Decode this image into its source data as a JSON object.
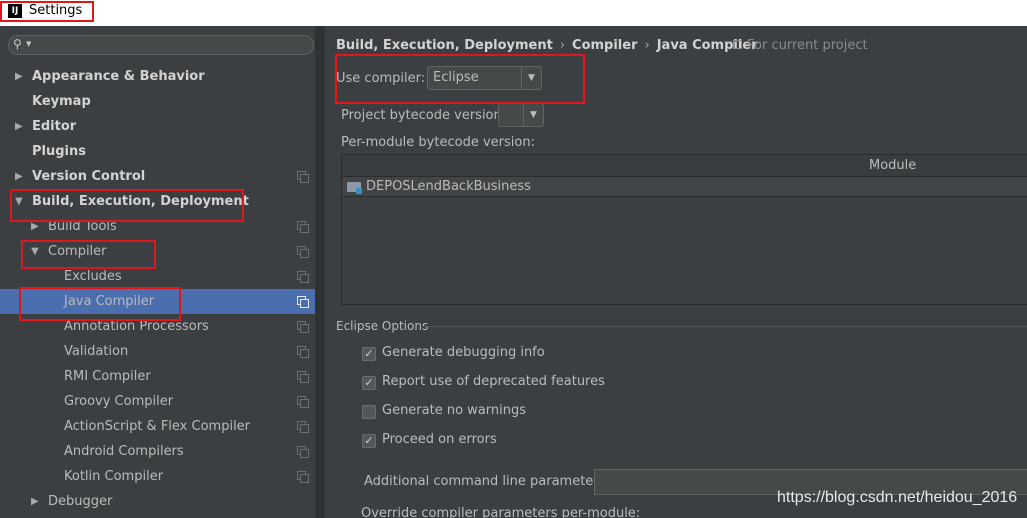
{
  "window": {
    "title": "Settings",
    "logo_text": "IJ"
  },
  "sidebar": {
    "search_placeholder": "",
    "items": [
      {
        "label": "Appearance & Behavior",
        "bold": true,
        "level": 0,
        "arrow": "▶",
        "project_icon": false
      },
      {
        "label": "Keymap",
        "bold": true,
        "level": 0,
        "arrow": "",
        "project_icon": false
      },
      {
        "label": "Editor",
        "bold": true,
        "level": 0,
        "arrow": "▶",
        "project_icon": false
      },
      {
        "label": "Plugins",
        "bold": true,
        "level": 0,
        "arrow": "",
        "project_icon": false
      },
      {
        "label": "Version Control",
        "bold": true,
        "level": 0,
        "arrow": "▶",
        "project_icon": true
      },
      {
        "label": "Build, Execution, Deployment",
        "bold": true,
        "level": 0,
        "arrow": "▼",
        "project_icon": false
      },
      {
        "label": "Build Tools",
        "bold": false,
        "level": 1,
        "arrow": "▶",
        "project_icon": true
      },
      {
        "label": "Compiler",
        "bold": false,
        "level": 1,
        "arrow": "▼",
        "project_icon": true
      },
      {
        "label": "Excludes",
        "bold": false,
        "level": 2,
        "arrow": "",
        "project_icon": true
      },
      {
        "label": "Java Compiler",
        "bold": false,
        "level": 2,
        "arrow": "",
        "project_icon": true,
        "selected": true
      },
      {
        "label": "Annotation Processors",
        "bold": false,
        "level": 2,
        "arrow": "",
        "project_icon": true
      },
      {
        "label": "Validation",
        "bold": false,
        "level": 2,
        "arrow": "",
        "project_icon": true
      },
      {
        "label": "RMI Compiler",
        "bold": false,
        "level": 2,
        "arrow": "",
        "project_icon": true
      },
      {
        "label": "Groovy Compiler",
        "bold": false,
        "level": 2,
        "arrow": "",
        "project_icon": true
      },
      {
        "label": "ActionScript & Flex Compiler",
        "bold": false,
        "level": 2,
        "arrow": "",
        "project_icon": true
      },
      {
        "label": "Android Compilers",
        "bold": false,
        "level": 2,
        "arrow": "",
        "project_icon": true
      },
      {
        "label": "Kotlin Compiler",
        "bold": false,
        "level": 2,
        "arrow": "",
        "project_icon": true
      },
      {
        "label": "Debugger",
        "bold": false,
        "level": 1,
        "arrow": "▶",
        "project_icon": false
      }
    ]
  },
  "breadcrumb": [
    "Build, Execution, Deployment",
    "Compiler",
    "Java Compiler"
  ],
  "for_current_project": "For current project",
  "use_compiler": {
    "label": "Use compiler:",
    "value": "Eclipse"
  },
  "bytecode": {
    "label": "Project bytecode version:",
    "value": ""
  },
  "per_module": {
    "label": "Per-module bytecode version:"
  },
  "module_table": {
    "header": "Module",
    "rows": [
      "DEPOSLendBackBusiness"
    ]
  },
  "eclipse_options": {
    "title": "Eclipse Options",
    "options": [
      {
        "label": "Generate debugging info",
        "checked": true
      },
      {
        "label": "Report use of deprecated features",
        "checked": true
      },
      {
        "label": "Generate no warnings",
        "checked": false
      },
      {
        "label": "Proceed on errors",
        "checked": true
      }
    ],
    "additional_params_label": "Additional command line parameters:",
    "additional_params_value": "",
    "override_label": "Override compiler parameters per-module:"
  },
  "watermark": "https://blog.csdn.net/heidou_2016",
  "colors": {
    "selection": "#4b6eaf",
    "highlight_border": "#e0161d",
    "background": "#3c3f41"
  }
}
